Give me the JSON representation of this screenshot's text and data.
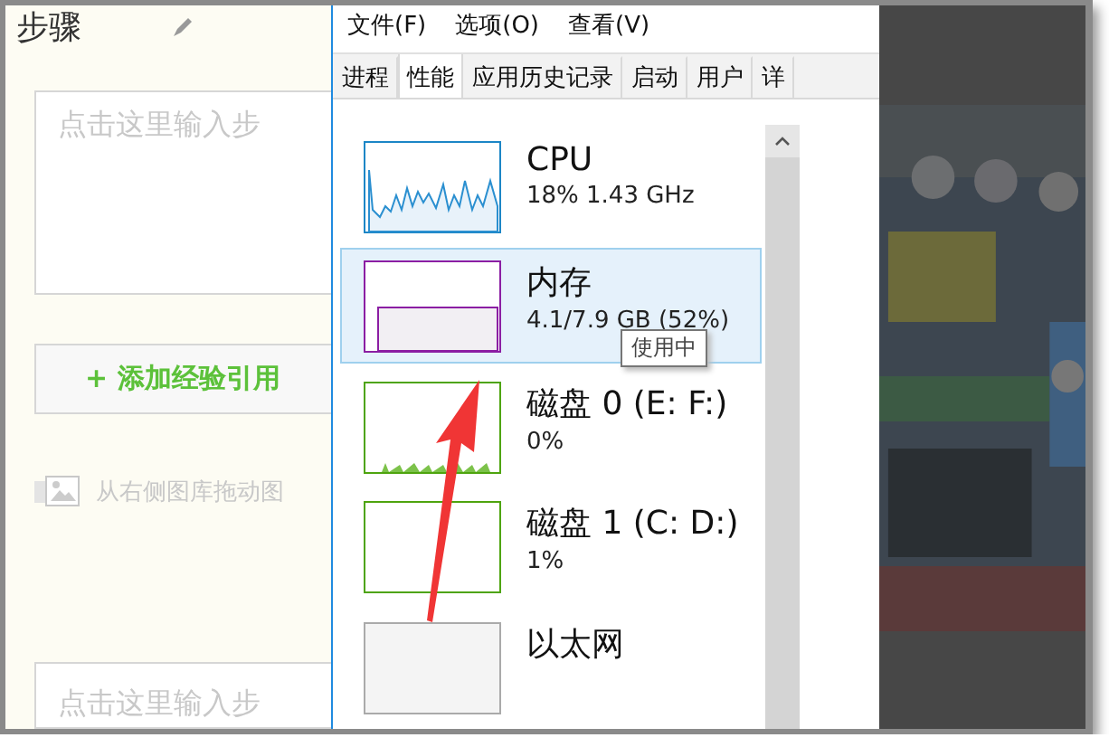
{
  "editor": {
    "heading": "步骤",
    "step_placeholder": "点击这里输入步",
    "add_button": "+ 添加经验引用",
    "image_hint": "从右侧图库拖动图",
    "next_step_placeholder": "点击这里输入步"
  },
  "task_manager": {
    "menu": [
      "文件(F)",
      "选项(O)",
      "查看(V)"
    ],
    "tabs": [
      {
        "label": "进程",
        "selected": false
      },
      {
        "label": "性能",
        "selected": true
      },
      {
        "label": "应用历史记录",
        "selected": false
      },
      {
        "label": "启动",
        "selected": false
      },
      {
        "label": "用户",
        "selected": false
      },
      {
        "label": "详",
        "selected": false
      }
    ],
    "resources": [
      {
        "kind": "cpu",
        "name": "CPU",
        "detail": "18% 1.43 GHz",
        "selected": false
      },
      {
        "kind": "memory",
        "name": "内存",
        "detail": "4.1/7.9 GB (52%)",
        "selected": true,
        "tooltip": "使用中"
      },
      {
        "kind": "disk",
        "name": "磁盘 0 (E: F:)",
        "detail": "0%",
        "selected": false
      },
      {
        "kind": "disk-idle",
        "name": "磁盘 1 (C: D:)",
        "detail": "1%",
        "selected": false
      },
      {
        "kind": "network",
        "name": "以太网",
        "selected": false
      }
    ]
  }
}
